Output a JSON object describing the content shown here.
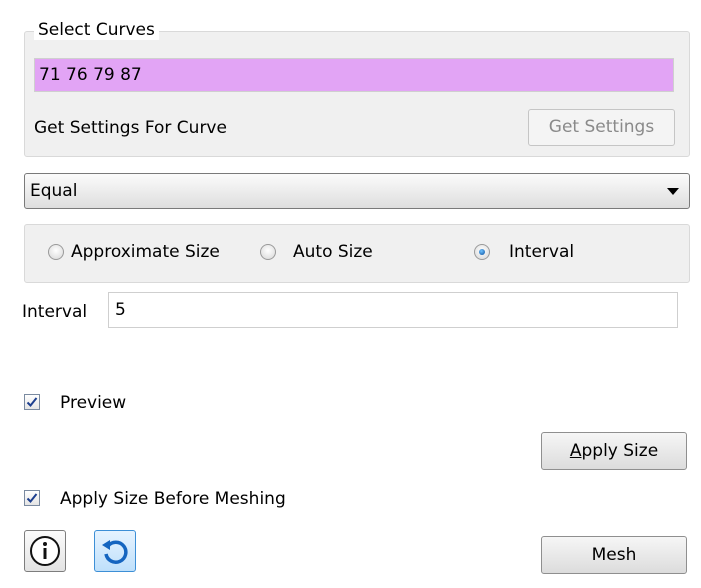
{
  "select_curves": {
    "group_title": "Select Curves",
    "curves_value": "71 76 79 87",
    "get_settings_label": "Get Settings For Curve",
    "get_settings_button": "Get Settings"
  },
  "scheme": {
    "selected": "Equal"
  },
  "size_mode": {
    "options": [
      "Approximate Size",
      "Auto Size",
      "Interval"
    ],
    "selected": "Interval"
  },
  "interval": {
    "label": "Interval",
    "value": "5"
  },
  "preview": {
    "label": "Preview",
    "checked": true
  },
  "apply_size": {
    "button_underlined": "A",
    "button_rest": "pply Size"
  },
  "apply_before_meshing": {
    "label": "Apply Size Before Meshing",
    "checked": true
  },
  "bottom_toolbar": {
    "info_icon": "info-icon",
    "reset_icon": "reset-icon",
    "mesh_button": "Mesh"
  },
  "colors": {
    "selection_field": "#e2a4f5",
    "radio_selected": "#0a4f9e",
    "reset_border": "#3d8fd6"
  }
}
